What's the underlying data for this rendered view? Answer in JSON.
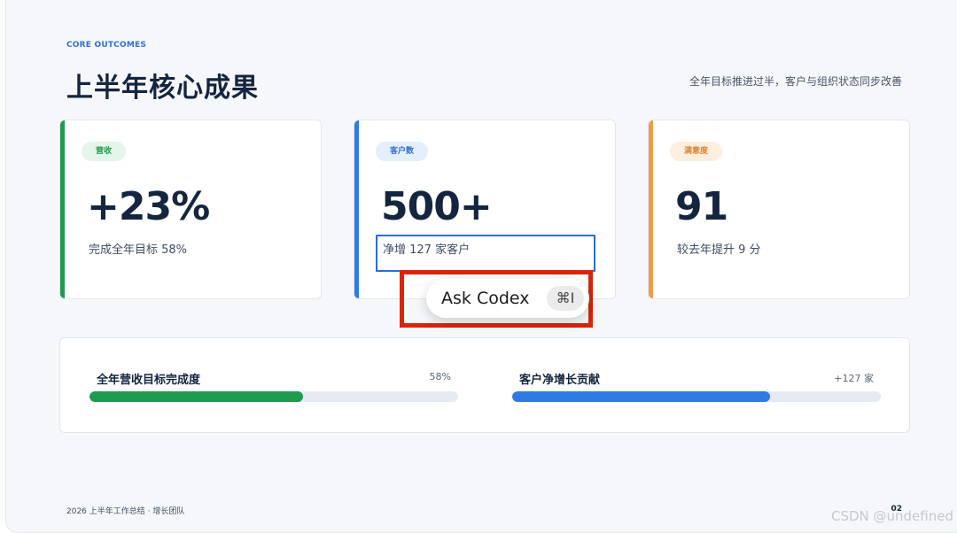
{
  "header": {
    "eyebrow": "CORE OUTCOMES",
    "title": "上半年核心成果",
    "subtitle": "全年目标推进过半，客户与组织状态同步改善"
  },
  "cards": [
    {
      "badge": "营收",
      "value": "+23%",
      "note": "完成全年目标 58%",
      "accent": "#1e9b4f",
      "badge_bg": "#e4f5ea",
      "badge_fg": "#1e9b4f"
    },
    {
      "badge": "客户数",
      "value": "500+",
      "note": "净增 127 家客户",
      "accent": "#2f7be3",
      "badge_bg": "#e5eefb",
      "badge_fg": "#2f6fdb"
    },
    {
      "badge": "满意度",
      "value": "91",
      "note": "较去年提升 9 分",
      "accent": "#f19a4a",
      "badge_bg": "#fdeedd",
      "badge_fg": "#e0842f"
    }
  ],
  "progress": [
    {
      "label": "全年营收目标完成度",
      "value": "58%",
      "fraction": 0.58,
      "color": "#1e9b4f"
    },
    {
      "label": "客户净增长贡献",
      "value": "+127 家",
      "fraction": 0.7,
      "color": "#2f7be3"
    }
  ],
  "footer": {
    "left": "2026 上半年工作总结 · 增长团队",
    "page": "02"
  },
  "popup": {
    "label": "Ask Codex",
    "shortcut": "⌘I"
  },
  "watermark": "CSDN @undefined"
}
